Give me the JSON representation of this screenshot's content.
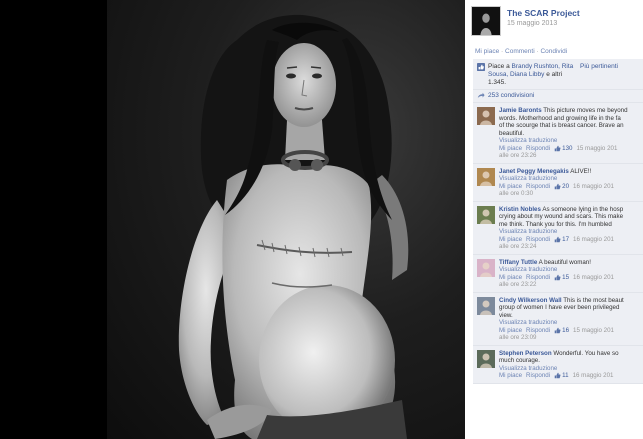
{
  "page": {
    "name": "The SCAR Project",
    "date": "15 maggio 2013"
  },
  "actions": {
    "like": "Mi piace",
    "comment": "Commenti",
    "share": "Condividi"
  },
  "likes_summary": {
    "prefix": "Piace a",
    "names": "Brandy Rushton, Rita Sousa, Diana Libby",
    "suffix": "e altri 1.345.",
    "more": "Più pertinenti"
  },
  "shares": "253 condivisioni",
  "comments": [
    {
      "author": "Jamie Baronts",
      "lines": [
        "This picture moves me beyond",
        "words. Motherhood and growing life in the fa",
        "of the scourge that is breast cancer. Brave an",
        "beautiful."
      ],
      "translate": "Visualizza traduzione",
      "like": "Mi piace",
      "reply": "Rispondi",
      "likes": "130",
      "date": "15 maggio 201",
      "time": "",
      "time_visible": "alle ore 23:26",
      "avatar_color": "#8b6a4f"
    },
    {
      "author": "Janet Peggy Menegakis",
      "lines": [
        "ALIVE!!"
      ],
      "translate": "Visualizza traduzione",
      "like": "Mi piace",
      "reply": "Rispondi",
      "likes": "20",
      "date": "16 maggio 201",
      "time_visible": "alle ore 0:30",
      "avatar_color": "#b08850"
    },
    {
      "author": "Kristin Nobles",
      "lines": [
        "As someone lying in the hosp",
        "crying about my wound and scars. This make",
        "me think. Thank you for this. I'm humbled"
      ],
      "translate": "Visualizza traduzione",
      "like": "Mi piace",
      "reply": "Rispondi",
      "likes": "17",
      "date": "16 maggio 201",
      "time_visible": "alle ore 23:24",
      "avatar_color": "#6b7d4f"
    },
    {
      "author": "Tiffany Tuttle",
      "lines": [
        "A beautiful woman!"
      ],
      "translate": "Visualizza traduzione",
      "like": "Mi piace",
      "reply": "Rispondi",
      "likes": "15",
      "date": "16 maggio 201",
      "time_visible": "alle ore 23:22",
      "avatar_color": "#d9b3c8"
    },
    {
      "author": "Cindy Wilkerson Wall",
      "lines": [
        "This is the most beaut",
        "group of women I have ever been privileged",
        "view."
      ],
      "translate": "Visualizza traduzione",
      "like": "Mi piace",
      "reply": "Rispondi",
      "likes": "16",
      "date": "15 maggio 201",
      "time_visible": "alle ore 23:09",
      "avatar_color": "#7d8a9c"
    },
    {
      "author": "Stephen Peterson",
      "lines": [
        "Wonderful. You have so",
        "much courage."
      ],
      "translate": "Visualizza traduzione",
      "like": "Mi piace",
      "reply": "Rispondi",
      "likes": "11",
      "date": "16 maggio 201",
      "time_visible": "",
      "avatar_color": "#5c6b5a"
    }
  ],
  "colors": {
    "link": "#3b5998",
    "panel_box": "#edeff4"
  }
}
